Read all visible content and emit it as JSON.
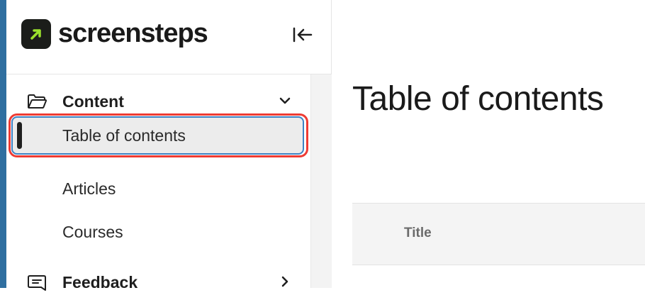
{
  "brand": {
    "name": "screensteps",
    "accent": "#9be22d",
    "mark_bg": "#1b1d1a"
  },
  "sidebar": {
    "collapse_icon": "collapse-left-icon",
    "sections": [
      {
        "label": "Content",
        "icon": "folder-icon",
        "expanded": true,
        "items": [
          {
            "label": "Table of contents",
            "active": true
          },
          {
            "label": "Articles",
            "active": false
          },
          {
            "label": "Courses",
            "active": false
          }
        ]
      },
      {
        "label": "Feedback",
        "icon": "feedback-icon",
        "expanded": false
      }
    ]
  },
  "main": {
    "title": "Table of contents",
    "table": {
      "columns": [
        "Title"
      ]
    }
  },
  "colors": {
    "highlight_border": "#ee3b33",
    "focus_border": "#3b82c4",
    "left_edge": "#2f6fa0"
  }
}
